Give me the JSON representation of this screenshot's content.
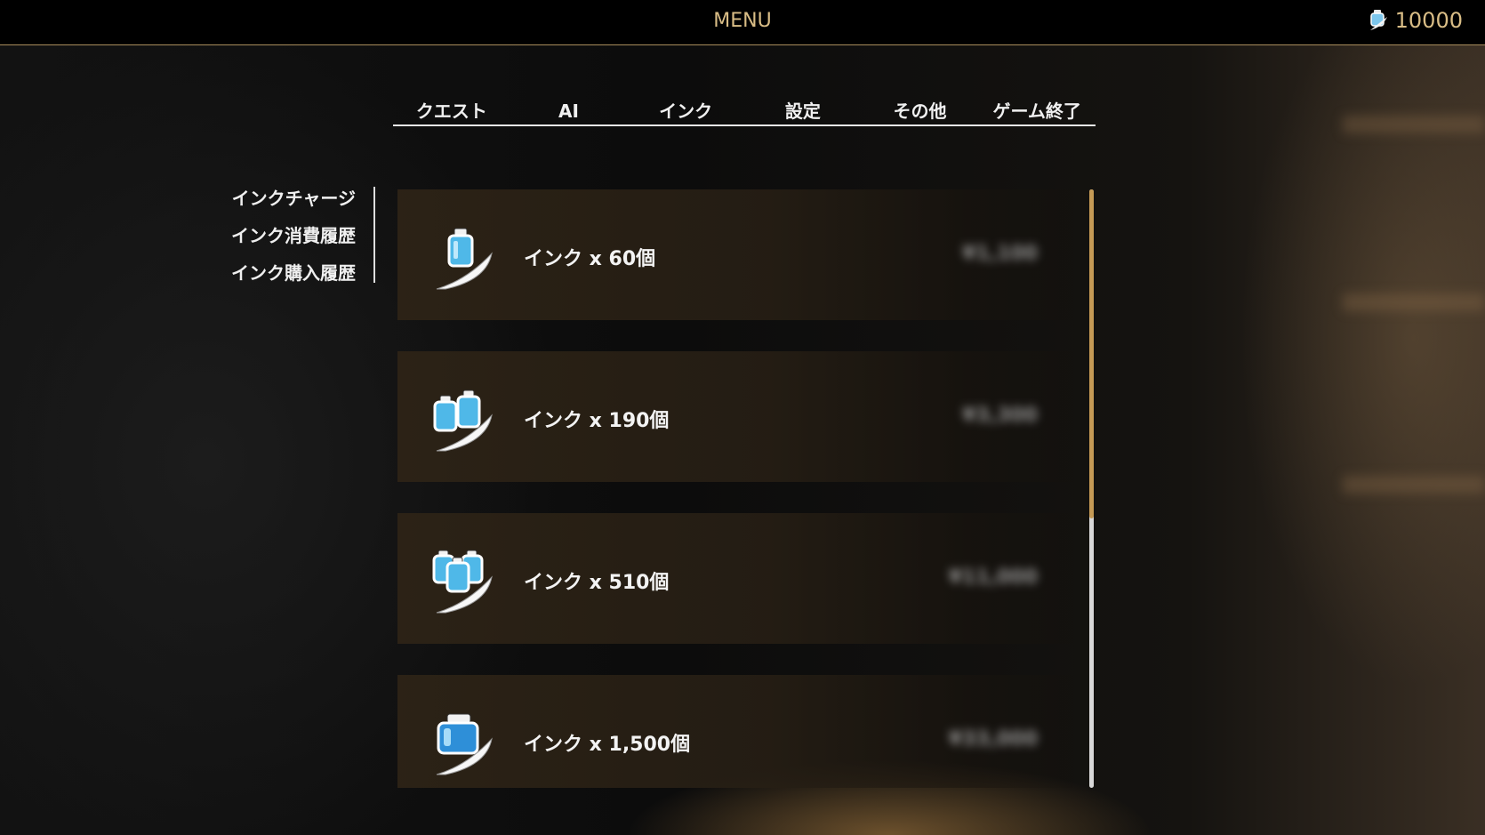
{
  "header": {
    "title": "MENU",
    "currency_amount": "10000",
    "currency_icon": "ink-bottle-icon"
  },
  "tabs": [
    {
      "label": "クエスト"
    },
    {
      "label": "AI"
    },
    {
      "label": "インク"
    },
    {
      "label": "設定"
    },
    {
      "label": "その他"
    },
    {
      "label": "ゲーム終了"
    }
  ],
  "submenu": [
    {
      "label": "インクチャージ"
    },
    {
      "label": "インク消費履歴"
    },
    {
      "label": "インク購入履歴"
    }
  ],
  "products": [
    {
      "label": "インク x 60個",
      "price": "¥1,100",
      "icon": "ink-bottle-single-icon"
    },
    {
      "label": "インク x 190個",
      "price": "¥3,300",
      "icon": "ink-bottles-double-icon"
    },
    {
      "label": "インク x 510個",
      "price": "¥11,000",
      "icon": "ink-bottles-triple-icon"
    },
    {
      "label": "インク x 1,500個",
      "price": "¥33,000",
      "icon": "ink-jar-large-icon"
    }
  ],
  "scrollbar": {
    "position_fraction": 0.0,
    "visible_fraction": 0.55
  },
  "colors": {
    "gold": "#d9bd86",
    "scroll_thumb": "#c59a55",
    "ink_blue": "#4fb8e8"
  }
}
